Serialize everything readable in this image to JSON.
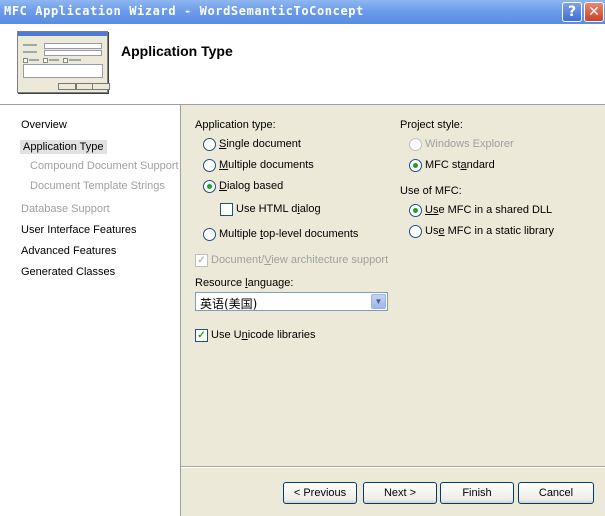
{
  "window": {
    "title": "MFC Application Wizard - WordSemanticToConcept"
  },
  "titlebar": {
    "help_glyph": "?",
    "close_glyph": "✕"
  },
  "header": {
    "title": "Application Type"
  },
  "nav": {
    "items": [
      {
        "label": "Overview",
        "state": "normal"
      },
      {
        "label": "Application Type",
        "state": "selected"
      },
      {
        "label": "Compound Document Support",
        "state": "disabled"
      },
      {
        "label": "Document Template Strings",
        "state": "disabled"
      },
      {
        "label": "Database Support",
        "state": "disabled"
      },
      {
        "label": "User Interface Features",
        "state": "normal"
      },
      {
        "label": "Advanced Features",
        "state": "normal"
      },
      {
        "label": "Generated Classes",
        "state": "normal"
      }
    ]
  },
  "app_type": {
    "label": "Application type:",
    "single_a": "S",
    "single_b": "ingle document",
    "multiple_a": "M",
    "multiple_b": "ultiple documents",
    "dialog_a": "D",
    "dialog_b": "ialog based",
    "html_a": "Use HTML d",
    "html_u": "i",
    "html_b": "alog",
    "toplevel_a": "Multiple ",
    "toplevel_u": "t",
    "toplevel_b": "op-level documents",
    "selected": "Dialog based"
  },
  "docview": {
    "a": "Document/",
    "u": "V",
    "b": "iew architecture support",
    "checked": true,
    "enabled": false
  },
  "resource": {
    "label_a": "Resource ",
    "label_u": "l",
    "label_b": "anguage:",
    "value": "英语(美国)",
    "arrow": "▼"
  },
  "unicode": {
    "a": "Use U",
    "u": "n",
    "b": "icode libraries",
    "checked": true
  },
  "project_style": {
    "label": "Project style:",
    "explorer": "Windows Explorer",
    "mfc_a": "MFC st",
    "mfc_u": "a",
    "mfc_b": "ndard",
    "selected": "MFC standard"
  },
  "use_mfc": {
    "label": "Use of MFC:",
    "shared_a": "U",
    "shared_u": "s",
    "shared_b": "e MFC in a shared DLL",
    "static_a": "Us",
    "static_u": "e",
    "static_b": " MFC in a static library",
    "selected": "Use MFC in a shared DLL"
  },
  "buttons": {
    "previous": "< Previous",
    "next": "Next >",
    "finish": "Finish",
    "cancel": "Cancel"
  },
  "glyphs": {
    "check": "✓"
  }
}
